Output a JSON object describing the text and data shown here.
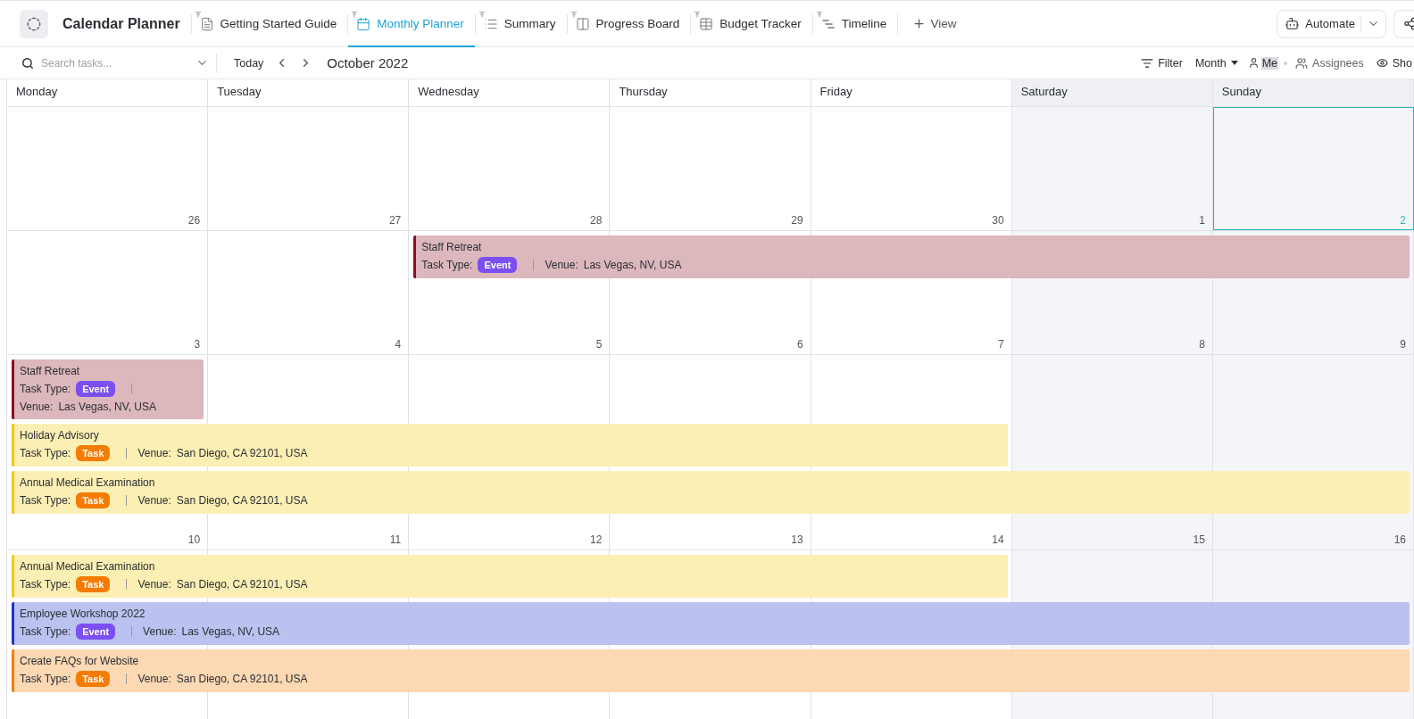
{
  "header": {
    "title": "Calendar Planner"
  },
  "tabs": [
    {
      "label": "Getting Started Guide",
      "kind": "doc",
      "selected": false
    },
    {
      "label": "Monthly Planner",
      "kind": "calendar",
      "selected": true
    },
    {
      "label": "Summary",
      "kind": "list",
      "selected": false
    },
    {
      "label": "Progress Board",
      "kind": "board",
      "selected": false
    },
    {
      "label": "Budget Tracker",
      "kind": "table",
      "selected": false
    },
    {
      "label": "Timeline",
      "kind": "timeline",
      "selected": false
    }
  ],
  "add_view": "View",
  "automate": "Automate",
  "toolbar": {
    "search_placeholder": "Search tasks...",
    "today": "Today",
    "month_title": "October 2022",
    "filter": "Filter",
    "view_mode": "Month",
    "me": "Me",
    "assignees": "Assignees",
    "show": "Sho"
  },
  "weekdays": [
    {
      "label": "Monday",
      "weekend": false
    },
    {
      "label": "Tuesday",
      "weekend": false
    },
    {
      "label": "Wednesday",
      "weekend": false
    },
    {
      "label": "Thursday",
      "weekend": false
    },
    {
      "label": "Friday",
      "weekend": false
    },
    {
      "label": "Saturday",
      "weekend": true
    },
    {
      "label": "Sunday",
      "weekend": true
    }
  ],
  "weeks": [
    {
      "days": [
        {
          "number": "26",
          "today": false
        },
        {
          "number": "27",
          "today": false
        },
        {
          "number": "28",
          "today": false
        },
        {
          "number": "29",
          "today": false
        },
        {
          "number": "30",
          "today": false
        },
        {
          "number": "1",
          "today": false
        },
        {
          "number": "2",
          "today": true
        }
      ]
    },
    {
      "days": [
        {
          "number": "3",
          "today": false
        },
        {
          "number": "4",
          "today": false
        },
        {
          "number": "5",
          "today": false,
          "events": [
            {
              "title": "Staff Retreat",
              "kind": "to_sunday",
              "type_label": "Task Type:",
              "badge": {
                "label": "Event",
                "color": "#7b4ff0"
              },
              "venue_label": "Venue:",
              "venue": "Las Vegas, NV, USA",
              "color": "#8b0e1e"
            }
          ]
        },
        {
          "number": "6",
          "today": false
        },
        {
          "number": "7",
          "today": false
        },
        {
          "number": "8",
          "today": false
        },
        {
          "number": "9",
          "today": false
        }
      ]
    },
    {
      "days": [
        {
          "number": "10",
          "today": false,
          "events": [
            {
              "title": "Staff Retreat",
              "kind": "one_day",
              "type_label": "Task Type:",
              "badge": {
                "label": "Event",
                "color": "#7b4ff0"
              },
              "venue_label": "Venue:",
              "venue": "Las Vegas, NV, USA",
              "color": "#8b0e1e"
            },
            {
              "title": "Holiday Advisory",
              "kind": "to_friday",
              "type_label": "Task Type:",
              "badge": {
                "label": "Task",
                "color": "#f57c00"
              },
              "venue_label": "Venue:",
              "venue": "San Diego, CA 92101, USA",
              "color": "#f5c800"
            },
            {
              "title": "Annual Medical Examination",
              "kind": "to_sunday",
              "type_label": "Task Type:",
              "badge": {
                "label": "Task",
                "color": "#f57c00"
              },
              "venue_label": "Venue:",
              "venue": "San Diego, CA 92101, USA",
              "color": "#f5c800"
            }
          ]
        },
        {
          "number": "11",
          "today": false
        },
        {
          "number": "12",
          "today": false
        },
        {
          "number": "13",
          "today": false
        },
        {
          "number": "14",
          "today": false
        },
        {
          "number": "15",
          "today": false
        },
        {
          "number": "16",
          "today": false
        }
      ]
    },
    {
      "days": [
        {
          "events": [
            {
              "title": "Annual Medical Examination",
              "kind": "to_friday",
              "type_label": "Task Type:",
              "badge": {
                "label": "Task",
                "color": "#f57c00"
              },
              "venue_label": "Venue:",
              "venue": "San Diego, CA 92101, USA",
              "color": "#f5c800"
            },
            {
              "title": "Employee Workshop 2022",
              "kind": "to_sunday",
              "type_label": "Task Type:",
              "badge": {
                "label": "Event",
                "color": "#7b4ff0"
              },
              "venue_label": "Venue:",
              "venue": "Las Vegas, NV, USA",
              "color": "#1c34c8"
            },
            {
              "title": "Create FAQs for Website",
              "kind": "to_sunday",
              "type_label": "Task Type:",
              "badge": {
                "label": "Task",
                "color": "#f57c00"
              },
              "venue_label": "Venue:",
              "venue": "San Diego, CA 92101, USA",
              "color": "#f57c00"
            }
          ]
        }
      ]
    }
  ]
}
